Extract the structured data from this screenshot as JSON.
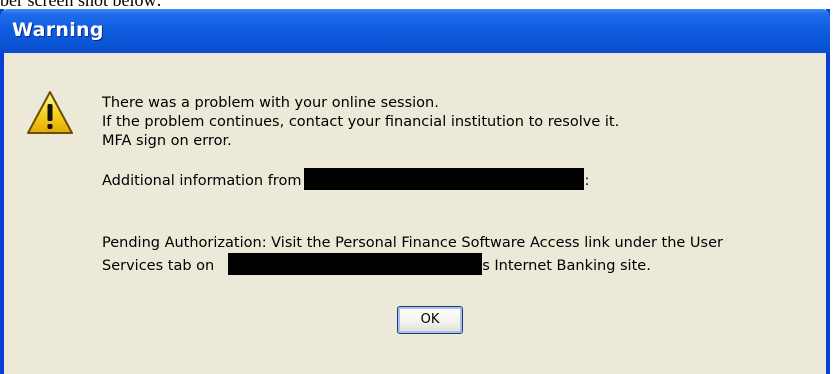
{
  "caption_partial": "ber screen shot below:",
  "dialog": {
    "title": "Warning",
    "lines": [
      "There was a problem with your online session.",
      "If the problem continues, contact your financial institution to resolve it.",
      "MFA sign on error."
    ],
    "additional_prefix": "Additional information from",
    "additional_suffix": ":",
    "pending_line1": "Pending Authorization: Visit the Personal Finance Software Access link under the User",
    "pending_line2_prefix": "Services tab on",
    "pending_line2_suffix": "s Internet Banking site.",
    "ok_label": "OK"
  },
  "icons": {
    "warning": "warning-triangle-icon"
  },
  "colors": {
    "titlebar": "#0b55d6",
    "dialog_bg": "#ece9d8",
    "icon_fill": "#f7d51e"
  }
}
